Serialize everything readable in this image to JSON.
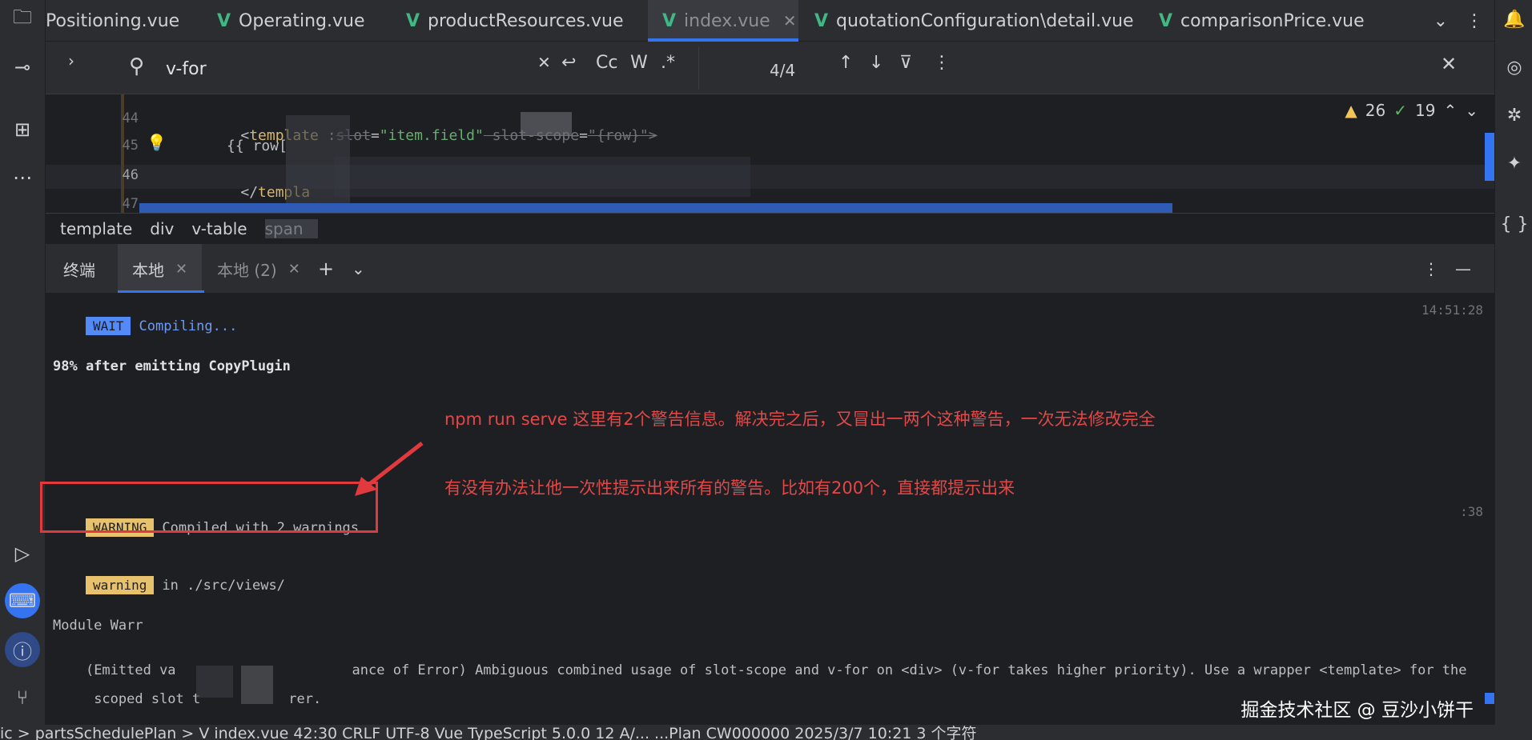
{
  "tabs": [
    {
      "label": "Positioning.vue"
    },
    {
      "label": "Operating.vue"
    },
    {
      "label": "productResources.vue"
    },
    {
      "label": "index.vue"
    },
    {
      "label": "quotationConfiguration\\detail.vue"
    },
    {
      "label": "comparisonPrice.vue"
    }
  ],
  "search": {
    "value": "v-for",
    "count": "4/4",
    "case_label": "Cc",
    "word_label": "W",
    "regex_label": ".*"
  },
  "editor": {
    "line_numbers": [
      "44",
      "45",
      "46",
      "47"
    ],
    "line44": {
      "open": "<",
      "tag": "template",
      "attr": " :",
      "slot_strike": "slot",
      "eq": "=",
      "val": "\"item.field\"",
      "slot_scope_strike": " slot-scope",
      "eq2": "=",
      "val2": "\"{row}\">"
    },
    "line45": "{{ row[",
    "line46": {
      "close_open": "</",
      "tag": "templa"
    },
    "warnings_count": "26",
    "ok_count": "19"
  },
  "breadcrumb": [
    "template",
    "div",
    "v-table",
    "span"
  ],
  "terminal_tabs": [
    {
      "label": "终端"
    },
    {
      "label": "本地"
    },
    {
      "label": "本地 (2)"
    }
  ],
  "terminal": {
    "wait_badge": "WAIT",
    "compiling": "Compiling...",
    "time1": "14:51:28",
    "progress": "98% after emitting CopyPlugin",
    "warning_badge": "WARNING",
    "compiled": "Compiled with 2 warnings",
    "time2": ":38",
    "warning_small_badge": "warning",
    "warning_path": "in ./src/views/",
    "module_warn": "Module Warr",
    "emitted_a": "(Emitted va",
    "emitted_b": "ance of Error) Ambiguous combined usage of slot-scope and v-for on <div> (v-for takes higher priority). Use a wrapper <template> for the",
    "scoped_a": " scoped slot t",
    "scoped_b": "rer."
  },
  "annotations": {
    "line1": "npm run serve 这里有2个警告信息。解决完之后，又冒出一两个这种警告，一次无法修改完全",
    "line2": "有没有办法让他一次性提示出来所有的警告。比如有200个，直接都提示出来"
  },
  "watermark": "掘金技术社区 @ 豆沙小饼干",
  "statusbar": {
    "text": "ic > partsSchedulePlan > V index.vue     42:30   CRLF   UTF-8    Vue TypeScript 5.0.0          12 A/...   ...Plan   CW000000 2025/3/7 10:21   3 个字符"
  },
  "colors": {
    "accent": "#3574f0",
    "vue_green": "#41b883",
    "annotation_red": "#e34848",
    "warn_yellow": "#e8c16d"
  }
}
